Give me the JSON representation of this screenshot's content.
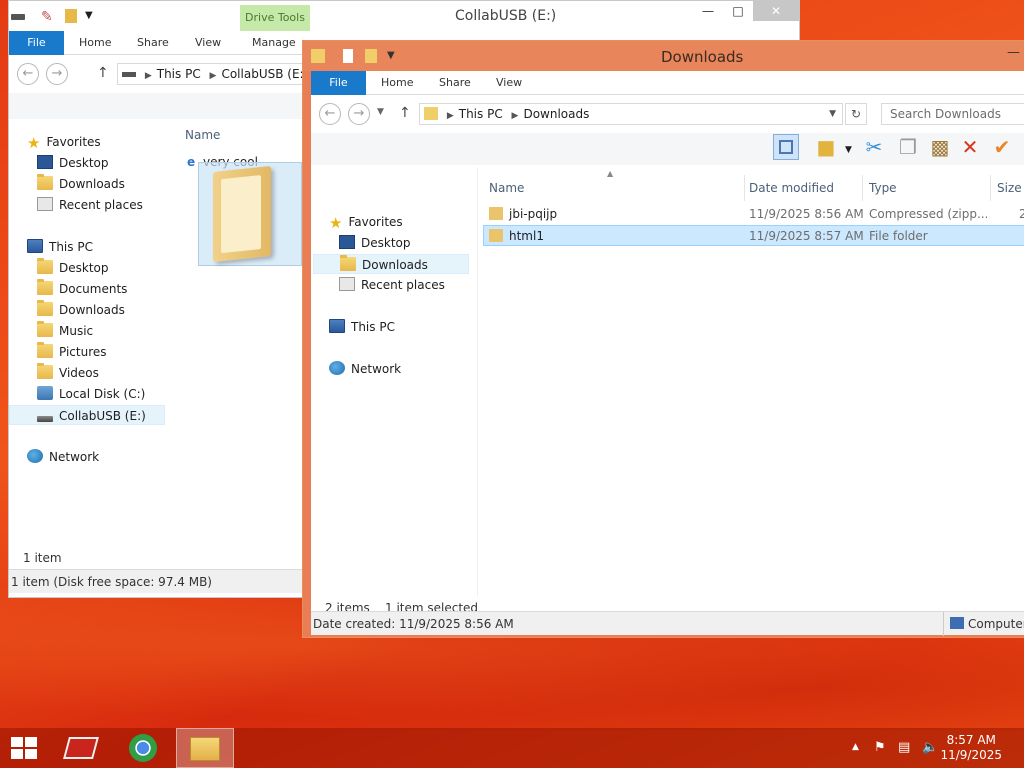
{
  "win1": {
    "title": "CollabUSB (E:)",
    "context_tab": "Drive Tools",
    "tabs": [
      "File",
      "Home",
      "Share",
      "View",
      "Manage"
    ],
    "crumbs": [
      "This PC",
      "CollabUSB (E:)"
    ],
    "tree": {
      "favorites": "Favorites",
      "fav_items": [
        "Desktop",
        "Downloads",
        "Recent places"
      ],
      "this_pc": "This PC",
      "pc_items": [
        "Desktop",
        "Documents",
        "Downloads",
        "Music",
        "Pictures",
        "Videos",
        "Local Disk (C:)",
        "CollabUSB (E:)"
      ],
      "network": "Network"
    },
    "col_name": "Name",
    "file": "very cool",
    "status_count": "1 item",
    "status_bar": "1 item (Disk free space: 97.4 MB)"
  },
  "win2": {
    "title": "Downloads",
    "tabs": [
      "File",
      "Home",
      "Share",
      "View"
    ],
    "crumbs": [
      "This PC",
      "Downloads"
    ],
    "search_placeholder": "Search Downloads",
    "tree": {
      "favorites": "Favorites",
      "fav_items": [
        "Desktop",
        "Downloads",
        "Recent places"
      ],
      "this_pc": "This PC",
      "network": "Network"
    },
    "columns": [
      "Name",
      "Date modified",
      "Type",
      "Size"
    ],
    "rows": [
      {
        "name": "jbi-pqijp",
        "date": "11/9/2025 8:56 AM",
        "type": "Compressed (zipp...",
        "size": "2"
      },
      {
        "name": "html1",
        "date": "11/9/2025 8:57 AM",
        "type": "File folder",
        "size": ""
      }
    ],
    "status_items": "2 items",
    "status_selected": "1 item selected",
    "details": "Date created: 11/9/2025 8:56 AM",
    "computer": "Computer"
  },
  "taskbar": {
    "time": "8:57 AM",
    "date": "11/9/2025"
  },
  "colors": {
    "accent": "#1979ca",
    "window_frame": "#e97e54",
    "context_tab": "#c5e9a8"
  }
}
